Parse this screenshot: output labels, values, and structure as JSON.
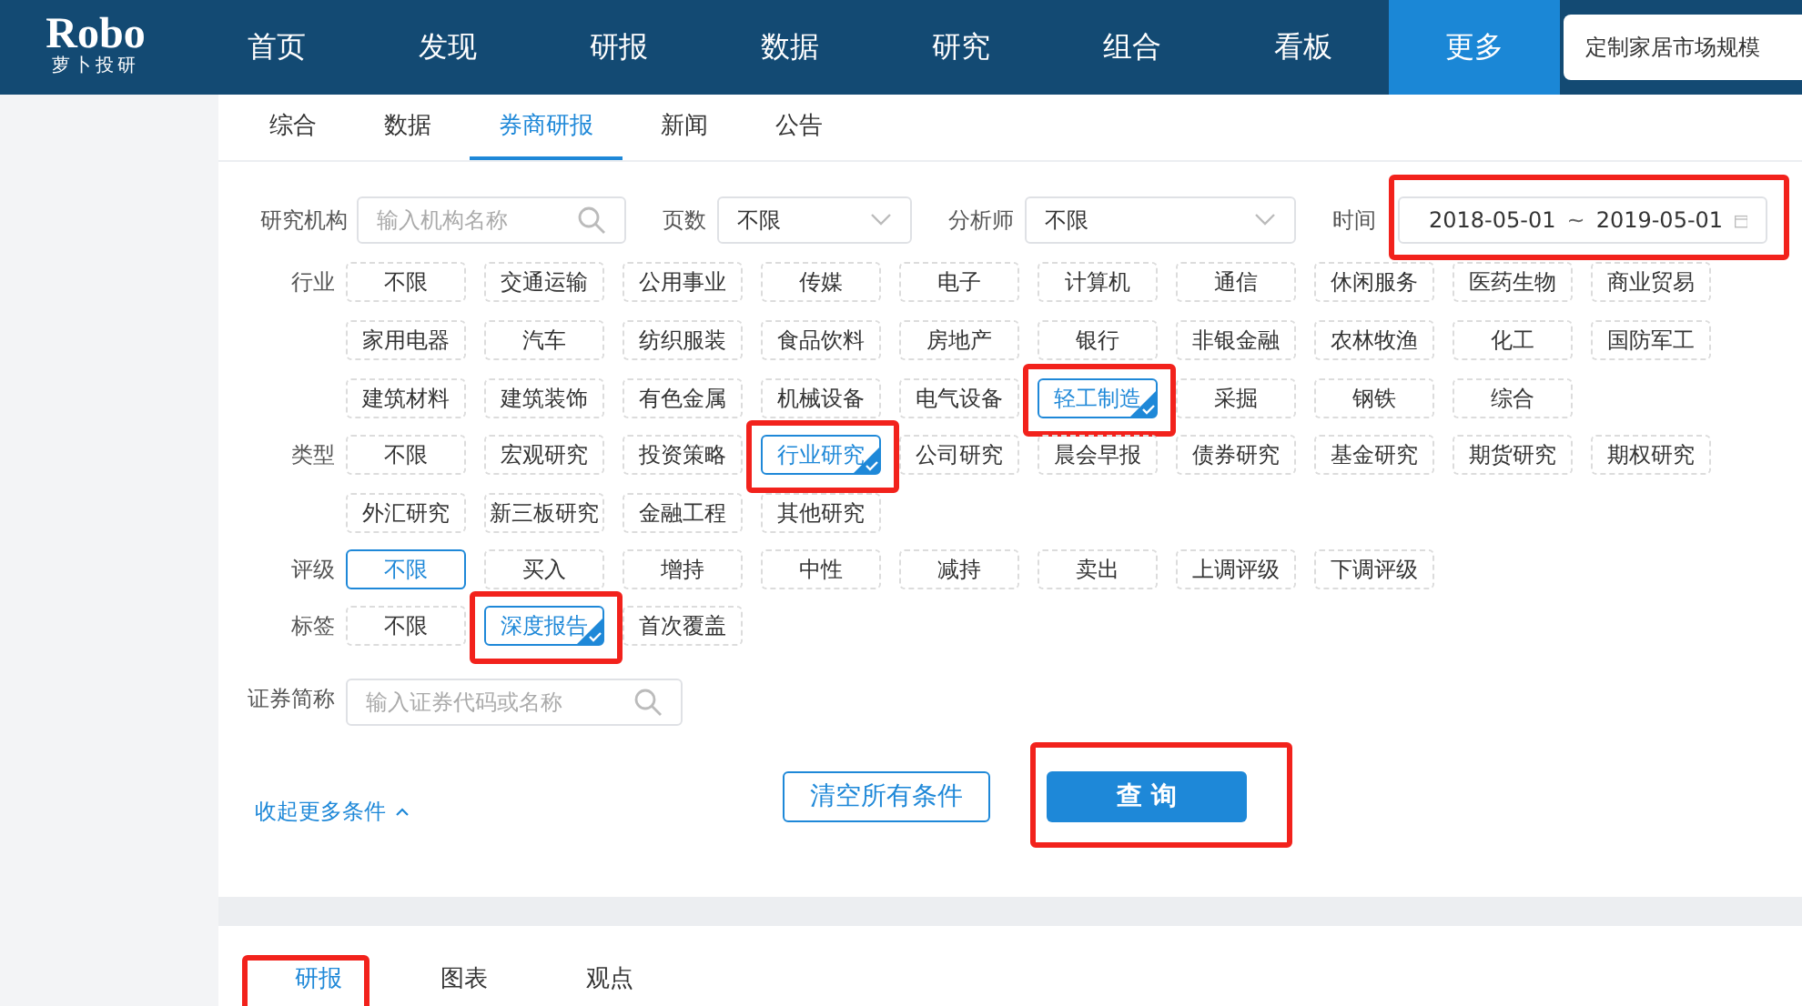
{
  "nav": {
    "logo": "Robo",
    "logo_subtitle": "萝卜投研",
    "items": [
      {
        "label": "首页",
        "selected": false
      },
      {
        "label": "发现",
        "selected": false
      },
      {
        "label": "研报",
        "selected": false
      },
      {
        "label": "数据",
        "selected": false
      },
      {
        "label": "研究",
        "selected": false
      },
      {
        "label": "组合",
        "selected": false
      },
      {
        "label": "看板",
        "selected": false
      },
      {
        "label": "更多",
        "selected": true
      }
    ],
    "search": {
      "value": "定制家居市场规模"
    }
  },
  "tabs": [
    {
      "label": "综合",
      "selected": false
    },
    {
      "label": "数据",
      "selected": false
    },
    {
      "label": "券商研报",
      "selected": true
    },
    {
      "label": "新闻",
      "selected": false
    },
    {
      "label": "公告",
      "selected": false
    }
  ],
  "filters": {
    "institution": {
      "label": "研究机构",
      "placeholder": "输入机构名称"
    },
    "pages": {
      "label": "页数",
      "value": "不限"
    },
    "analyst": {
      "label": "分析师",
      "value": "不限"
    },
    "time": {
      "label": "时间",
      "start": "2018-05-01",
      "separator": "~",
      "end": "2019-05-01",
      "annotated": true
    }
  },
  "chip_groups": [
    {
      "label": "行业",
      "kind": "multi",
      "options": [
        {
          "label": "不限",
          "selected": false,
          "annotated": false
        },
        {
          "label": "交通运输",
          "selected": false,
          "annotated": false
        },
        {
          "label": "公用事业",
          "selected": false,
          "annotated": false
        },
        {
          "label": "传媒",
          "selected": false,
          "annotated": false
        },
        {
          "label": "电子",
          "selected": false,
          "annotated": false
        },
        {
          "label": "计算机",
          "selected": false,
          "annotated": false
        },
        {
          "label": "通信",
          "selected": false,
          "annotated": false
        },
        {
          "label": "休闲服务",
          "selected": false,
          "annotated": false
        },
        {
          "label": "医药生物",
          "selected": false,
          "annotated": false
        },
        {
          "label": "商业贸易",
          "selected": false,
          "annotated": false
        },
        {
          "label": "家用电器",
          "selected": false,
          "annotated": false
        },
        {
          "label": "汽车",
          "selected": false,
          "annotated": false
        },
        {
          "label": "纺织服装",
          "selected": false,
          "annotated": false
        },
        {
          "label": "食品饮料",
          "selected": false,
          "annotated": false
        },
        {
          "label": "房地产",
          "selected": false,
          "annotated": false
        },
        {
          "label": "银行",
          "selected": false,
          "annotated": false
        },
        {
          "label": "非银金融",
          "selected": false,
          "annotated": false
        },
        {
          "label": "农林牧渔",
          "selected": false,
          "annotated": false
        },
        {
          "label": "化工",
          "selected": false,
          "annotated": false
        },
        {
          "label": "国防军工",
          "selected": false,
          "annotated": false
        },
        {
          "label": "建筑材料",
          "selected": false,
          "annotated": false
        },
        {
          "label": "建筑装饰",
          "selected": false,
          "annotated": false
        },
        {
          "label": "有色金属",
          "selected": false,
          "annotated": false
        },
        {
          "label": "机械设备",
          "selected": false,
          "annotated": false
        },
        {
          "label": "电气设备",
          "selected": false,
          "annotated": false
        },
        {
          "label": "轻工制造",
          "selected": true,
          "annotated": true
        },
        {
          "label": "采掘",
          "selected": false,
          "annotated": false
        },
        {
          "label": "钢铁",
          "selected": false,
          "annotated": false
        },
        {
          "label": "综合",
          "selected": false,
          "annotated": false
        }
      ]
    },
    {
      "label": "类型",
      "kind": "multi",
      "options": [
        {
          "label": "不限",
          "selected": false,
          "annotated": false
        },
        {
          "label": "宏观研究",
          "selected": false,
          "annotated": false
        },
        {
          "label": "投资策略",
          "selected": false,
          "annotated": false
        },
        {
          "label": "行业研究",
          "selected": true,
          "annotated": true
        },
        {
          "label": "公司研究",
          "selected": false,
          "annotated": false
        },
        {
          "label": "晨会早报",
          "selected": false,
          "annotated": false
        },
        {
          "label": "债券研究",
          "selected": false,
          "annotated": false
        },
        {
          "label": "基金研究",
          "selected": false,
          "annotated": false
        },
        {
          "label": "期货研究",
          "selected": false,
          "annotated": false
        },
        {
          "label": "期权研究",
          "selected": false,
          "annotated": false
        },
        {
          "label": "外汇研究",
          "selected": false,
          "annotated": false
        },
        {
          "label": "新三板研究",
          "selected": false,
          "annotated": false
        },
        {
          "label": "金融工程",
          "selected": false,
          "annotated": false
        },
        {
          "label": "其他研究",
          "selected": false,
          "annotated": false
        }
      ]
    },
    {
      "label": "评级",
      "kind": "single",
      "options": [
        {
          "label": "不限",
          "selected": true,
          "annotated": false
        },
        {
          "label": "买入",
          "selected": false,
          "annotated": false
        },
        {
          "label": "增持",
          "selected": false,
          "annotated": false
        },
        {
          "label": "中性",
          "selected": false,
          "annotated": false
        },
        {
          "label": "减持",
          "selected": false,
          "annotated": false
        },
        {
          "label": "卖出",
          "selected": false,
          "annotated": false
        },
        {
          "label": "上调评级",
          "selected": false,
          "annotated": false
        },
        {
          "label": "下调评级",
          "selected": false,
          "annotated": false
        }
      ]
    },
    {
      "label": "标签",
      "kind": "multi",
      "options": [
        {
          "label": "不限",
          "selected": false,
          "annotated": false
        },
        {
          "label": "深度报告",
          "selected": true,
          "annotated": true
        },
        {
          "label": "首次覆盖",
          "selected": false,
          "annotated": false
        }
      ]
    }
  ],
  "security": {
    "label": "证券简称",
    "placeholder": "输入证券代码或名称"
  },
  "collapse_link": "收起更多条件",
  "buttons": {
    "clear": {
      "label": "清空所有条件"
    },
    "query": {
      "label": "查 询",
      "annotated": true
    }
  },
  "result_tabs": [
    {
      "label": "研报",
      "selected": true,
      "annotated": true
    },
    {
      "label": "图表",
      "selected": false,
      "annotated": false
    },
    {
      "label": "观点",
      "selected": false,
      "annotated": false
    }
  ]
}
